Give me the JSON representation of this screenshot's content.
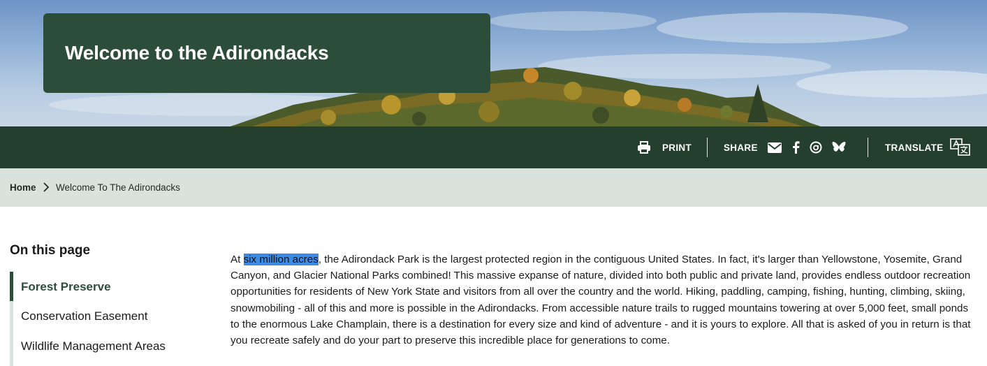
{
  "hero": {
    "title": "Welcome to the Adirondacks"
  },
  "toolbar": {
    "print_label": "PRINT",
    "share_label": "SHARE",
    "translate_label": "TRANSLATE",
    "share_icons": [
      "email-icon",
      "facebook-icon",
      "threads-icon",
      "bluesky-icon"
    ],
    "print_icon": "printer-icon",
    "translate_icon": "translate-icon"
  },
  "breadcrumb": {
    "home": "Home",
    "current": "Welcome To The Adirondacks"
  },
  "sidebar": {
    "title": "On this page",
    "items": [
      {
        "label": "Forest Preserve",
        "active": true
      },
      {
        "label": "Conservation Easement",
        "active": false
      },
      {
        "label": "Wildlife Management Areas",
        "active": false
      }
    ]
  },
  "main": {
    "intro_prefix": "At ",
    "intro_highlight": "six million acres",
    "intro_rest": ", the Adirondack Park is the largest protected region in the contiguous United States. In fact, it's larger than Yellowstone, Yosemite, Grand Canyon, and Glacier National Parks combined! This massive expanse of nature, divided into both public and private land, provides endless outdoor recreation opportunities for residents of New York State and visitors from all over the country and the world. Hiking, paddling, camping, fishing, hunting, climbing, skiing, snowmobiling - all of this and more is possible in the Adirondacks. From accessible nature trails to rugged mountains towering at over 5,000 feet, small ponds to the enormous Lake Champlain, there is a destination for every size and kind of adventure - and it is yours to explore. All that is asked of you in return is that you recreate safely and do your part to preserve this incredible place for generations to come."
  },
  "colors": {
    "header_green": "#253f2e",
    "title_box_green": "#2c4d39",
    "breadcrumb_bg": "#d9e2dc",
    "selection_blue": "#3c8ce7"
  }
}
